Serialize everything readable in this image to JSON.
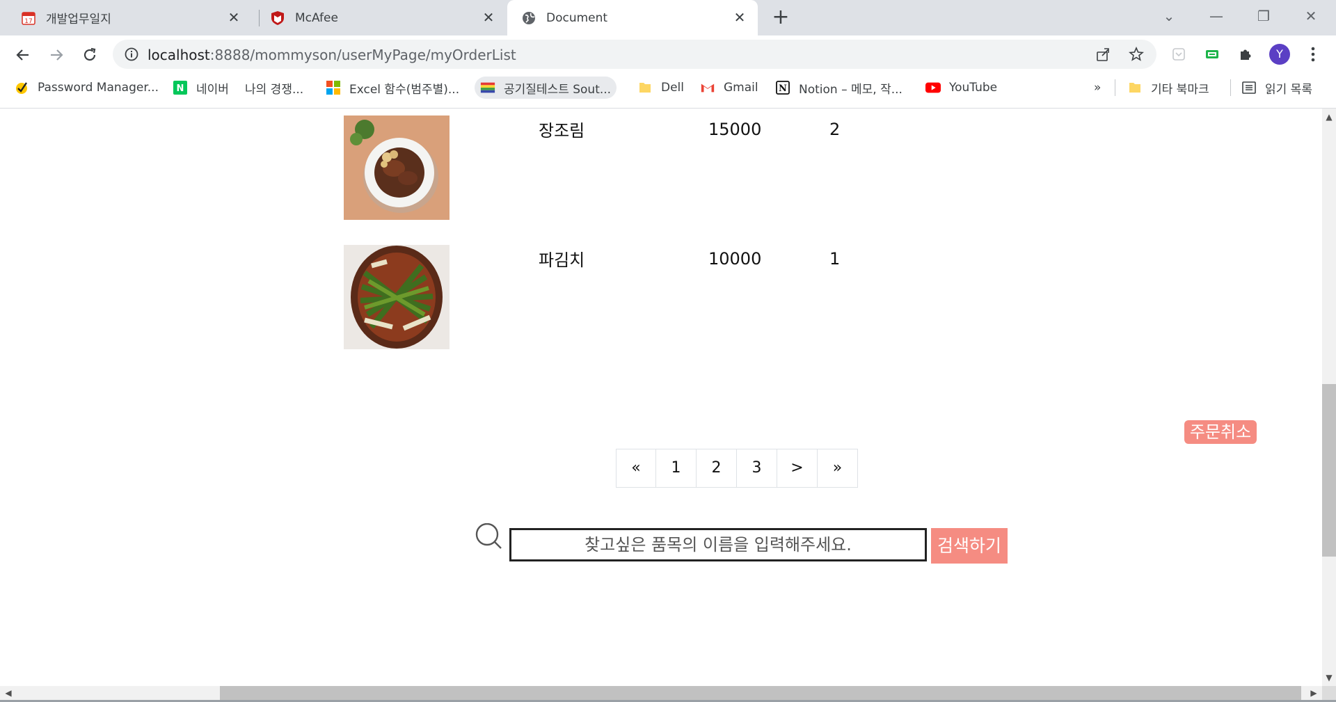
{
  "tabs": [
    {
      "title": "개발업무일지",
      "active": false
    },
    {
      "title": "McAfee",
      "active": false
    },
    {
      "title": "Document",
      "active": true
    }
  ],
  "address_bar": {
    "host": "localhost",
    "path": ":8888/mommyson/userMyPage/myOrderList"
  },
  "profile_initial": "Y",
  "bookmarks": [
    {
      "label": "Password Manager...",
      "icon": "norton-check-icon"
    },
    {
      "label": "네이버",
      "icon": "naver-icon"
    },
    {
      "label": "나의 경쟁...",
      "icon": "none"
    },
    {
      "label": "Excel 함수(범주별)...",
      "icon": "microsoft-icon"
    },
    {
      "label": "공기질테스트 Sout...",
      "icon": "rainbow-icon"
    },
    {
      "label": "Dell",
      "icon": "folder-icon"
    },
    {
      "label": "Gmail",
      "icon": "gmail-icon"
    },
    {
      "label": "Notion – 메모, 작...",
      "icon": "notion-icon"
    },
    {
      "label": "YouTube",
      "icon": "youtube-icon"
    }
  ],
  "bookmarks_overflow": "»",
  "other_bookmarks": "기타 북마크",
  "reading_list": "읽기 목록",
  "orders": [
    {
      "name": "장조림",
      "price": "15000",
      "quantity": "2",
      "image": "jangjorim-photo"
    },
    {
      "name": "파김치",
      "price": "10000",
      "quantity": "1",
      "image": "pakimchi-photo"
    }
  ],
  "cancel_order_label": "주문취소",
  "pagination": [
    "«",
    "1",
    "2",
    "3",
    ">",
    "»"
  ],
  "search": {
    "placeholder": "찾고싶은 품목의 이름을 입력해주세요.",
    "button_label": "검색하기"
  },
  "colors": {
    "accent": "#f58c82",
    "tabstrip": "#dee1e6",
    "avatar": "#5b3fc4"
  }
}
